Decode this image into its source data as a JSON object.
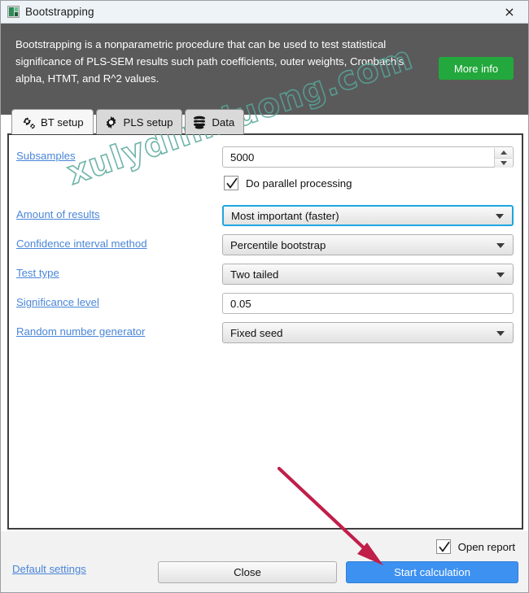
{
  "window": {
    "title": "Bootstrapping",
    "app_icon": "app-squares-icon",
    "close_label": "×"
  },
  "header": {
    "description": "Bootstrapping is a nonparametric procedure that can be used to test statistical significance of PLS-SEM results such path coefficients, outer weights, Cronbach's alpha, HTMT, and R^2 values.",
    "more_info_label": "More info",
    "more_info_color": "#22a83c",
    "background_color": "#5a5a5a"
  },
  "tabs": [
    {
      "label": "BT setup",
      "icon": "gears-icon",
      "active": true
    },
    {
      "label": "PLS setup",
      "icon": "gear-icon",
      "active": false
    },
    {
      "label": "Data",
      "icon": "database-icon",
      "active": false
    }
  ],
  "form": {
    "subsamples": {
      "label": "Subsamples",
      "value": "5000",
      "type": "number-spinner"
    },
    "parallel": {
      "label": "Do parallel processing",
      "checked": true
    },
    "amount_of_results": {
      "label": "Amount of results",
      "value": "Most important (faster)",
      "focused": true
    },
    "confidence_interval_method": {
      "label": "Confidence interval method",
      "value": "Percentile bootstrap"
    },
    "test_type": {
      "label": "Test type",
      "value": "Two tailed"
    },
    "significance_level": {
      "label": "Significance level",
      "value": "0.05"
    },
    "random_number_generator": {
      "label": "Random number generator",
      "value": "Fixed seed"
    }
  },
  "watermark": {
    "text": "xulydinhluong.com",
    "color": "#57a79a"
  },
  "footer": {
    "open_report_label": "Open report",
    "open_report_checked": true,
    "default_settings_label": "Default settings",
    "close_label": "Close",
    "start_label": "Start calculation",
    "start_color": "#3d91f0"
  },
  "annotation": {
    "arrow_color": "#c01f4a",
    "arrow_from": "342,575",
    "arrow_to": "468,692"
  }
}
